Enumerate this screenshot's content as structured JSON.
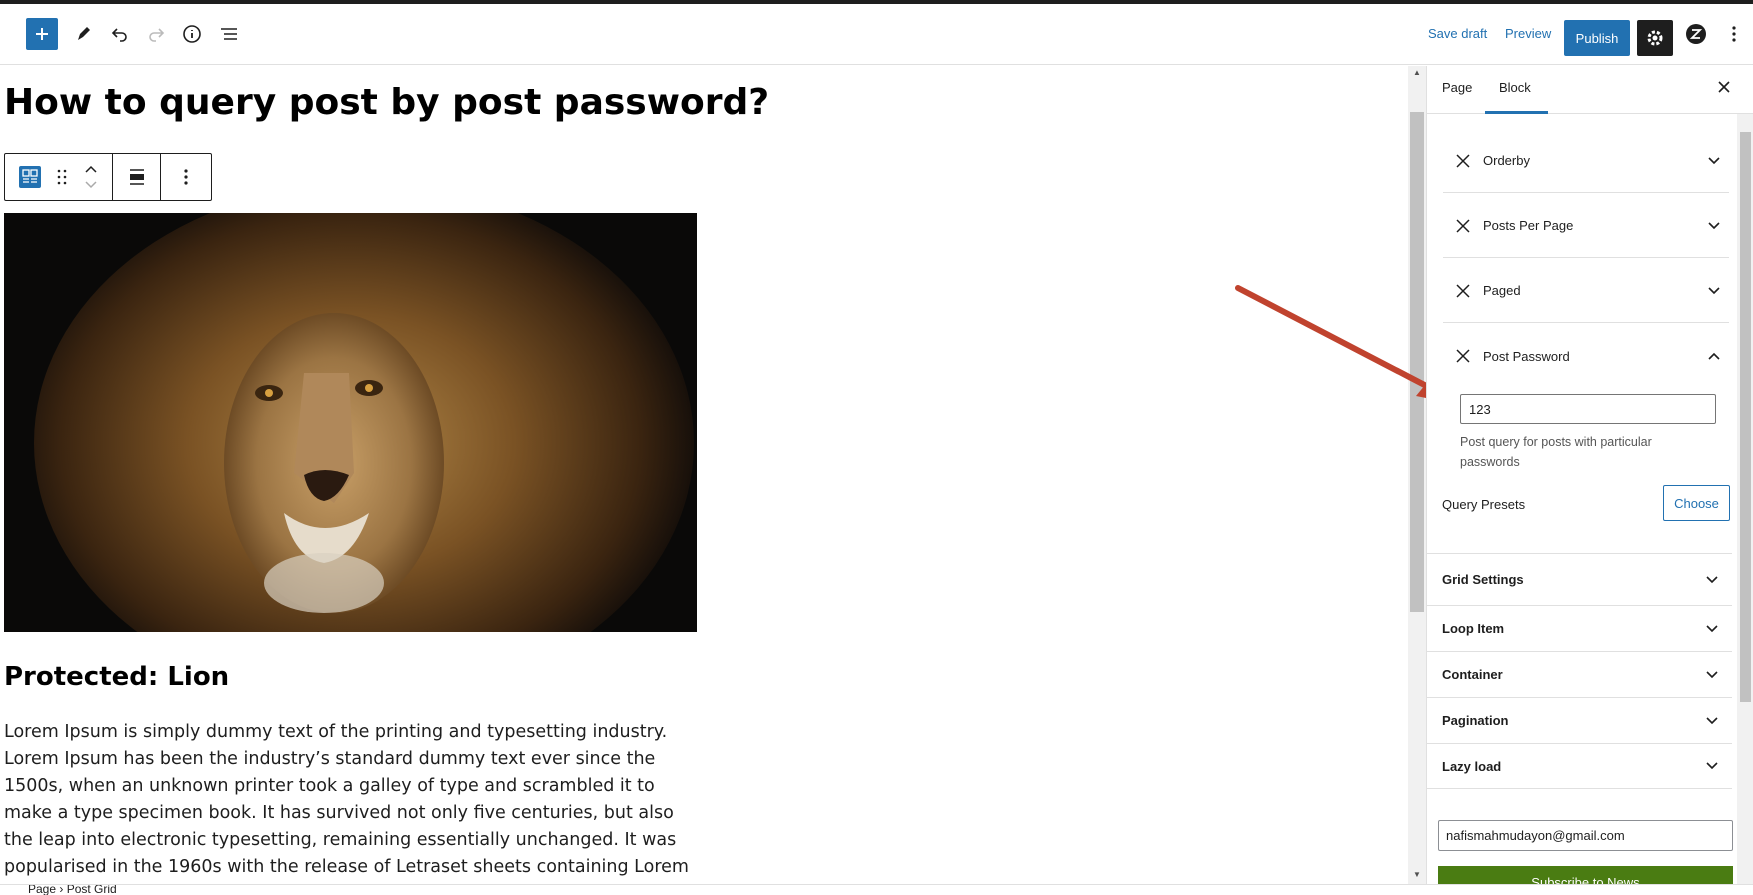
{
  "toolbar": {
    "save_draft": "Save draft",
    "preview": "Preview",
    "publish": "Publish"
  },
  "editor": {
    "title": "How to query post by post password?",
    "protected_heading": "Protected: Lion",
    "body": "Lorem Ipsum is simply dummy text of the printing and typesetting industry. Lorem Ipsum has been the industry’s standard dummy text ever since the 1500s, when an unknown printer took a galley of type and scrambled it to make a type specimen book. It has survived not only five centuries, but also the leap into electronic typesetting, remaining essentially unchanged. It was popularised in the 1960s with the release of Letraset sheets containing Lorem Ipsum passages, and more recently with desktop",
    "image_alt": "Lion"
  },
  "sidebar": {
    "tabs": [
      "Page",
      "Block"
    ],
    "active_tab": "Block",
    "query_items": [
      {
        "label": "Orderby",
        "expanded": false
      },
      {
        "label": "Posts Per Page",
        "expanded": false
      },
      {
        "label": "Paged",
        "expanded": false
      },
      {
        "label": "Post Password",
        "expanded": true
      }
    ],
    "post_password_value": "123",
    "post_password_help": "Post query for posts with particular passwords",
    "query_presets_label": "Query Presets",
    "choose_label": "Choose",
    "panels": [
      "Grid Settings",
      "Loop Item",
      "Container",
      "Pagination",
      "Lazy load"
    ],
    "email_value": "nafismahmudayon@gmail.com",
    "subscribe_label": "Subscribe to News"
  },
  "footer": {
    "breadcrumb": "Page › Post Grid"
  },
  "colors": {
    "accent": "#2271b1",
    "annotation_arrow": "#c0432e",
    "subscribe_bg": "#4a7c12"
  }
}
